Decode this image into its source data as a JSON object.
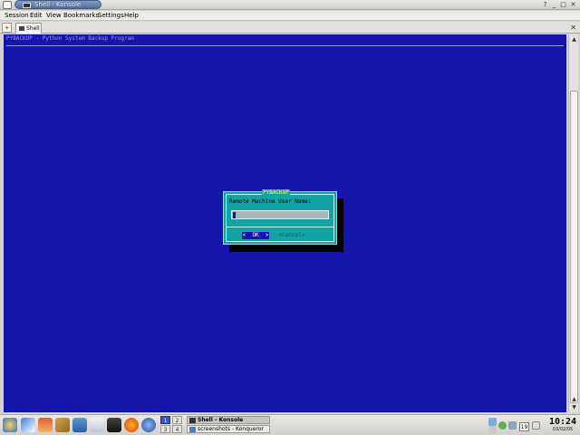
{
  "window": {
    "title": "Shell - Konsole",
    "controls": [
      "help",
      "minimize",
      "maximize",
      "close"
    ]
  },
  "menubar": {
    "items": [
      "Session",
      "Edit",
      "View",
      "Bookmarks",
      "Settings",
      "Help"
    ]
  },
  "tabs": {
    "items": [
      {
        "label": "Shell",
        "icon": "terminal-icon"
      }
    ]
  },
  "terminal": {
    "header": "PYBACKUP - Python System Backup Program",
    "colors": {
      "background": "#1515ab",
      "dialog": "#14a3a3",
      "dialog_title": "#ffff66"
    }
  },
  "dialog": {
    "title": "PYBACKUP",
    "prompt": "Remote Machine User Name:",
    "input_value": "",
    "ok_label": "<  OK  >",
    "cancel_label": "<Cancel>"
  },
  "taskbar": {
    "launchers": [
      "kde-menu-icon",
      "edit-icon",
      "home-icon",
      "tools-icon",
      "network-icon",
      "document-icon",
      "terminal-icon",
      "firefox-icon",
      "browser-icon"
    ],
    "pager": [
      "1",
      "2",
      "3",
      "4"
    ],
    "active_desktop": "1",
    "tasks": [
      {
        "label": "Shell - Konsole",
        "active": true
      },
      {
        "label": "screenshots - Konqueror",
        "active": false
      }
    ],
    "tray": {
      "calendar_day": "19"
    },
    "clock": {
      "time": "10:24",
      "date": "03/02/05"
    }
  }
}
